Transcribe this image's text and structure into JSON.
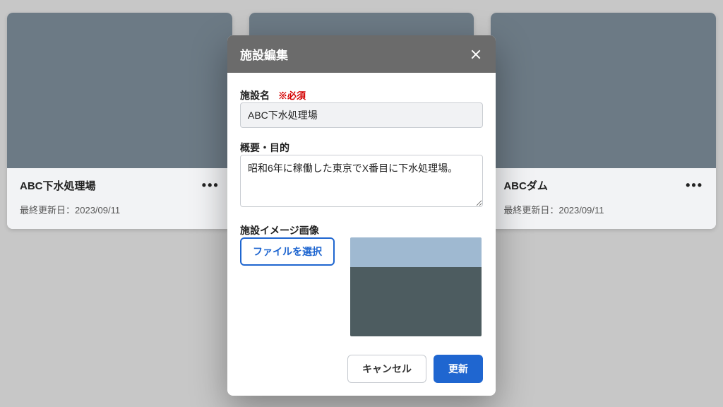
{
  "cards": [
    {
      "title": "ABC下水処理場",
      "updated": "最終更新日：2023/09/11"
    },
    {
      "title": "",
      "updated": ""
    },
    {
      "title": "ABCダム",
      "updated": "最終更新日：2023/09/11"
    }
  ],
  "modal": {
    "header": "施設編集",
    "name_label": "施設名",
    "required_mark": "※必須",
    "name_value": "ABC下水処理場",
    "desc_label": "概要・目的",
    "desc_value": "昭和6年に稼働した東京でX番目に下水処理場。",
    "image_label": "施設イメージ画像",
    "choose_file": "ファイルを選択",
    "cancel": "キャンセル",
    "submit": "更新"
  }
}
